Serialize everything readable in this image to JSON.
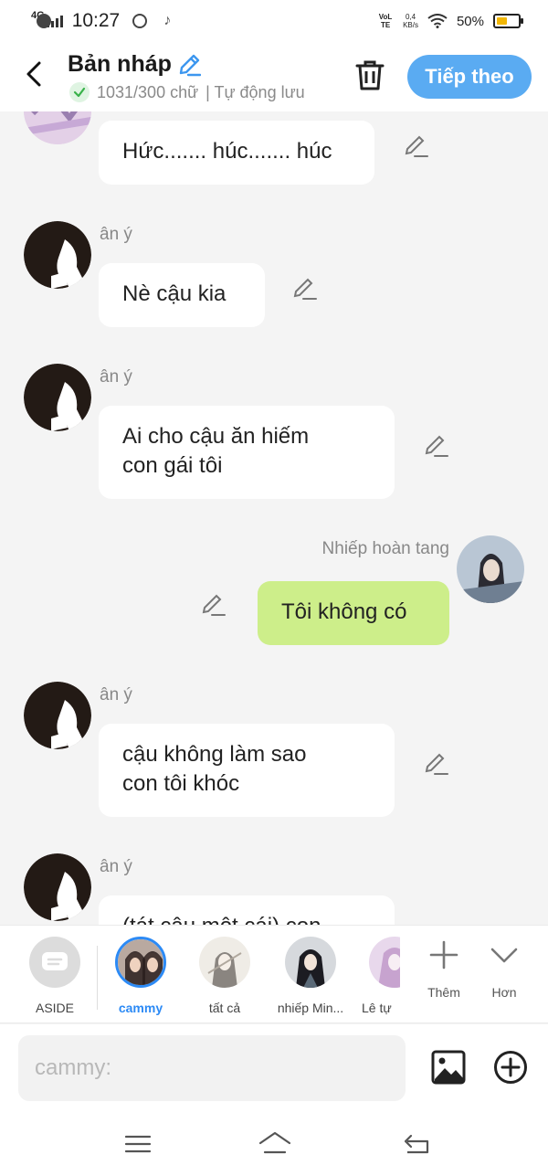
{
  "status_bar": {
    "network": "4G",
    "time": "10:27",
    "volte": "VoLTE",
    "speed_value": "0,4",
    "speed_unit": "KB/s",
    "battery_pct": "50%",
    "battery_level": 0.5
  },
  "header": {
    "title": "Bản nháp",
    "word_count": "1031/300 chữ",
    "autosave": "| Tự động lưu",
    "next_label": "Tiếp theo"
  },
  "messages": [
    {
      "sender": "",
      "text": "Hức....... húc....... húc",
      "mine": false
    },
    {
      "sender": "ân ý",
      "text": "Nè cậu kia",
      "mine": false
    },
    {
      "sender": "ân ý",
      "text": "Ai cho cậu ăn hiếm\ncon gái tôi",
      "mine": false
    },
    {
      "sender": "Nhiếp hoàn tang",
      "text": "Tôi không có",
      "mine": true
    },
    {
      "sender": "ân ý",
      "text": "cậu không làm sao\ncon tôi khóc",
      "mine": false
    },
    {
      "sender": "ân ý",
      "text": "(tát cậu một cái) con",
      "mine": false
    }
  ],
  "characters": [
    {
      "name": "ASIDE"
    },
    {
      "name": "cammy",
      "active": true
    },
    {
      "name": "tất cả"
    },
    {
      "name": "nhiếp Min..."
    },
    {
      "name": "Lê tự"
    }
  ],
  "tools": {
    "add_label": "Thêm",
    "more_label": "Hơn"
  },
  "composer": {
    "placeholder": "cammy:"
  },
  "colors": {
    "accent": "#5aabf2",
    "my_bubble": "#cdee8a",
    "active_char": "#2c8af5"
  }
}
